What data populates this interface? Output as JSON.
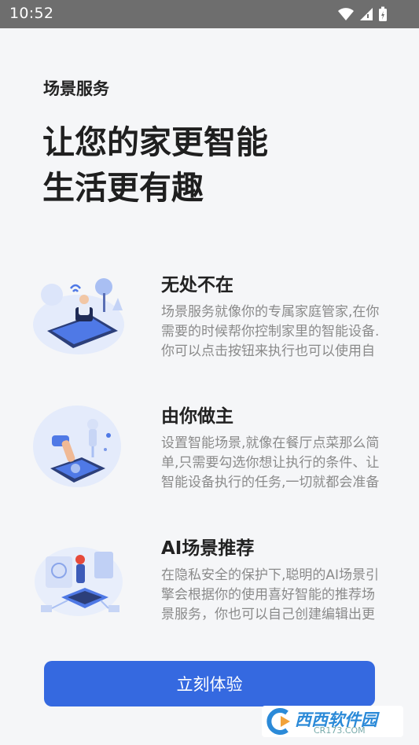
{
  "status_bar": {
    "time": "10:52"
  },
  "header": {
    "eyebrow": "场景服务",
    "headline_line1": "让您的家更智能",
    "headline_line2": "生活更有趣"
  },
  "features": [
    {
      "title": "无处不在",
      "description": "场景服务就像你的专属家庭管家,在你需要的时候帮你控制家里的智能设备.你可以点击按钮来执行也可以使用自动执行"
    },
    {
      "title": "由你做主",
      "description": "设置智能场景,就像在餐厅点菜那么简单,只需要勾选你想让执行的条件、让智能设备执行的任务,一切就都会准备就绪"
    },
    {
      "title": "AI场景推荐",
      "description": "在隐私安全的保护下,聪明的AI场景引擎会根据你的使用喜好智能的推荐场景服务，你也可以自己创建编辑出更个性化的场景"
    }
  ],
  "cta": {
    "label": "立刻体验"
  },
  "watermark": {
    "main": "西西软件园",
    "sub": "CR173.COM"
  },
  "colors": {
    "accent": "#3569e0",
    "status_bar": "#6e6e6e",
    "background": "#f5f6f8"
  }
}
